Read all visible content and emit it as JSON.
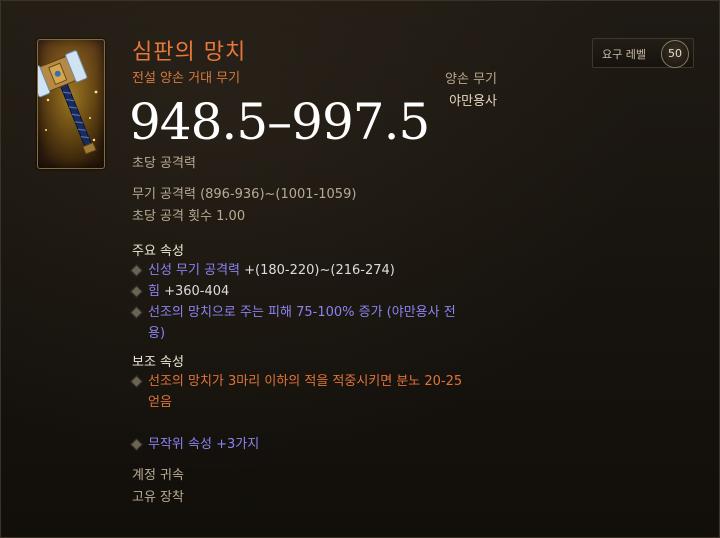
{
  "item": {
    "name": "심판의 망치",
    "rarity_type": "전설 양손 거대 무기",
    "slot": "양손 무기",
    "class": "야만용사",
    "dps": "948.5–997.5",
    "dps_label": "초당 공격력",
    "weapon_damage": "무기 공격력 (896-936)~(1001-1059)",
    "attack_speed": "초당 공격 횟수 1.00",
    "icon": "hammer-icon"
  },
  "level": {
    "label": "요구 레벨",
    "value": "50"
  },
  "primary": {
    "header": "주요 속성",
    "items": [
      {
        "prefix": "신성 무기 공격력",
        "value": " +(180-220)~(216-274)"
      },
      {
        "prefix": "힘",
        "value": " +360-404"
      },
      {
        "line1": "선조의 망치으로 주는 피해 75-100%  증가 (야만용사 전",
        "line2": "용)"
      }
    ]
  },
  "secondary": {
    "header": "보조 속성",
    "items": [
      {
        "line1": "선조의 망치가 3마리 이하의 적을 적중시키면 분노 20-25",
        "line2": "얻음"
      }
    ]
  },
  "random": {
    "prefix": "무작위 속성",
    "value": " +3가지"
  },
  "footer": {
    "account_bound": "계정 귀속",
    "unique_equip": "고유 장착"
  },
  "colors": {
    "legendary": "#e8773a",
    "magic": "#8a83f0",
    "background": "#1a1611"
  }
}
